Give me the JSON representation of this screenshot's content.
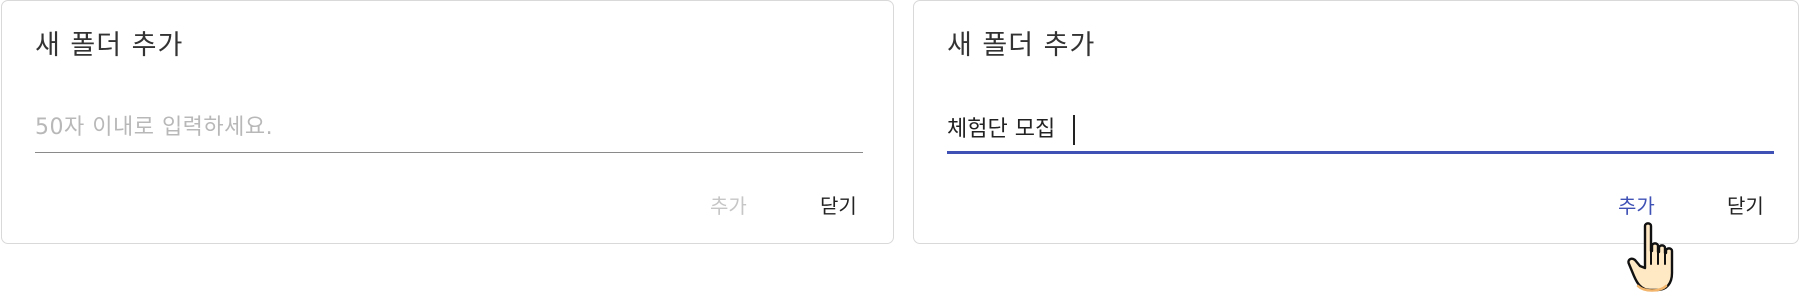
{
  "dialogs": [
    {
      "title": "새 폴더 추가",
      "input": {
        "value": "",
        "placeholder": "50자 이내로 입력하세요."
      },
      "add_label": "추가",
      "close_label": "닫기"
    },
    {
      "title": "새 폴더 추가",
      "input": {
        "value": "체험단 모집",
        "placeholder": ""
      },
      "add_label": "추가",
      "close_label": "닫기"
    }
  ],
  "icons": {
    "pointer": "hand-pointer-cursor-icon"
  },
  "colors": {
    "accent": "#3f51b5",
    "disabled_text": "#c6c6c6",
    "border": "#d9d9d9"
  }
}
